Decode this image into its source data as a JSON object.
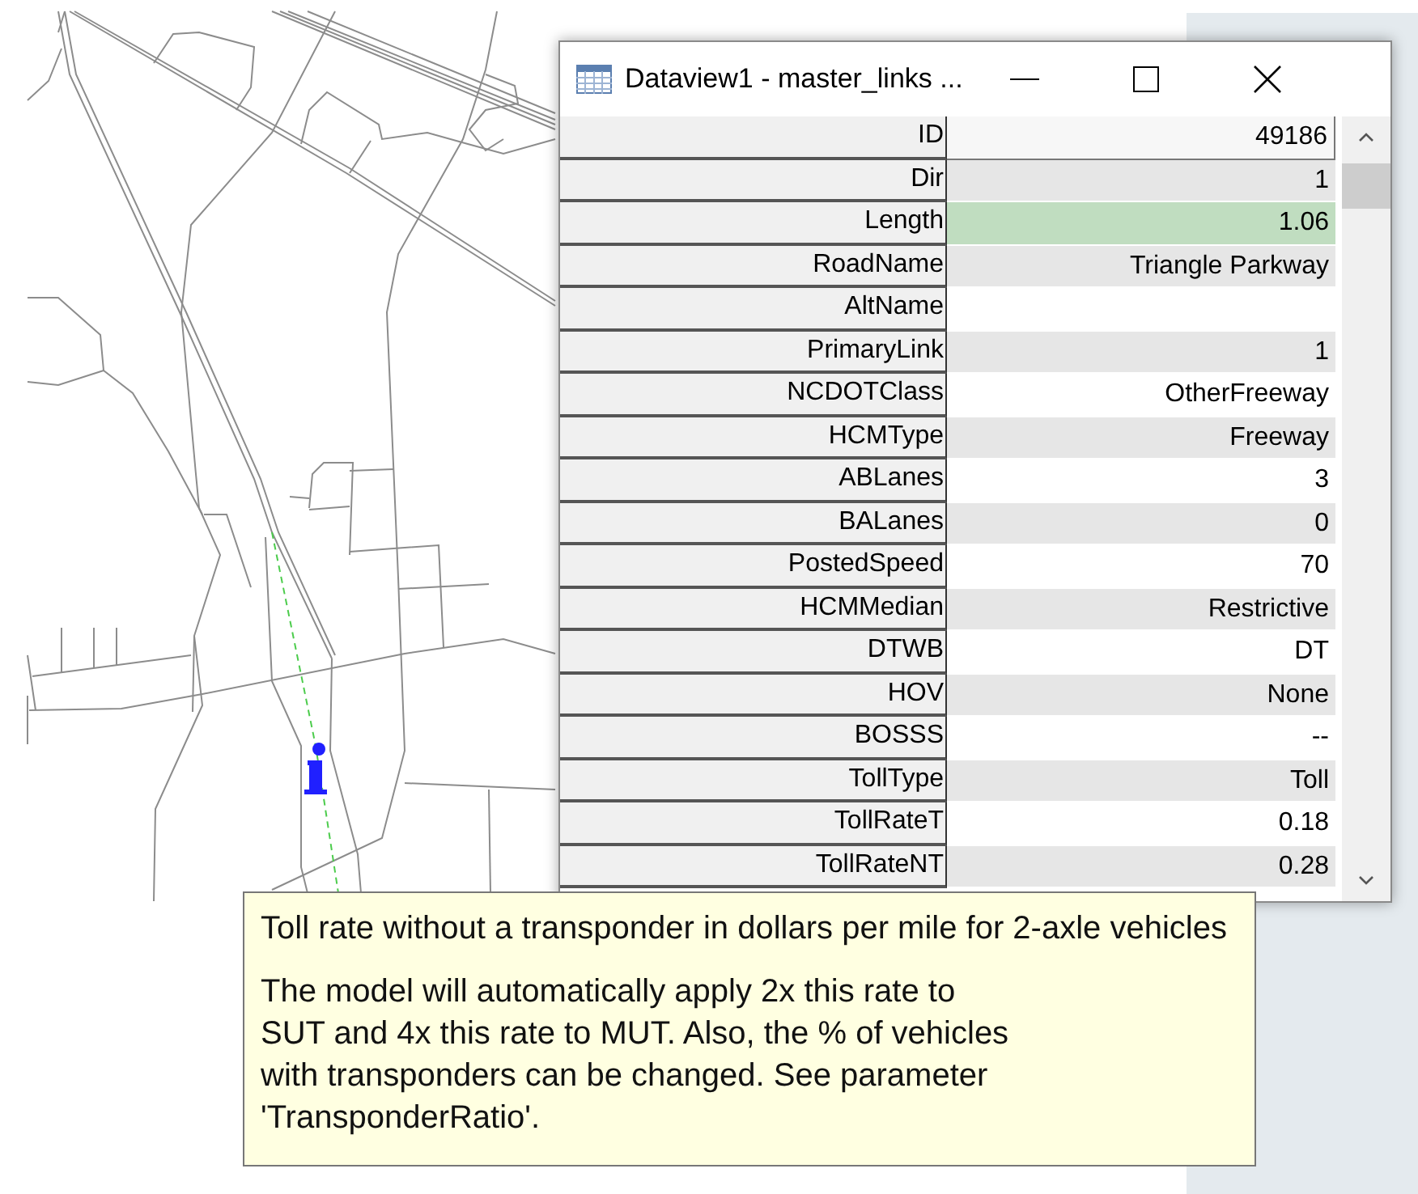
{
  "window": {
    "title": "Dataview1 - master_links ..."
  },
  "rows": [
    {
      "field": "ID",
      "value": "49186",
      "kind": "id",
      "highlighted": false
    },
    {
      "field": "Dir",
      "value": "1",
      "kind": "data",
      "highlighted": false
    },
    {
      "field": "Length",
      "value": "1.06",
      "kind": "data",
      "highlighted": true
    },
    {
      "field": "RoadName",
      "value": "Triangle Parkway",
      "kind": "data",
      "highlighted": false
    },
    {
      "field": "AltName",
      "kind": "data",
      "highlighted": false
    },
    {
      "field": "PrimaryLink",
      "value": "1",
      "kind": "data",
      "highlighted": false
    },
    {
      "field": "NCDOTClass",
      "value": "OtherFreeway",
      "kind": "data",
      "highlighted": false
    },
    {
      "field": "HCMType",
      "value": "Freeway",
      "kind": "data",
      "highlighted": false
    },
    {
      "field": "ABLanes",
      "value": "3",
      "kind": "data",
      "highlighted": false
    },
    {
      "field": "BALanes",
      "value": "0",
      "kind": "data",
      "highlighted": false
    },
    {
      "field": "PostedSpeed",
      "value": "70",
      "kind": "data",
      "highlighted": false
    },
    {
      "field": "HCMMedian",
      "value": "Restrictive",
      "kind": "data",
      "highlighted": false
    },
    {
      "field": "DTWB",
      "value": "DT",
      "kind": "data",
      "highlighted": false
    },
    {
      "field": "HOV",
      "value": "None",
      "kind": "data",
      "highlighted": false
    },
    {
      "field": "BOSSS",
      "value": "--",
      "kind": "data",
      "highlighted": false
    },
    {
      "field": "TollType",
      "value": "Toll",
      "kind": "data",
      "highlighted": false
    },
    {
      "field": "TollRateT",
      "value": "0.18",
      "kind": "data",
      "highlighted": false
    },
    {
      "field": "TollRateNT",
      "value": "0.28",
      "kind": "data",
      "highlighted": false
    }
  ],
  "tooltip": {
    "heading": "Toll rate without a transponder in dollars per mile for 2-axle vehicles",
    "body": "The model will automatically apply 2x this rate to SUT and 4x this rate to MUT. Also, the % of vehicles with transponders can be changed. See parameter 'TransponderRatio'."
  }
}
